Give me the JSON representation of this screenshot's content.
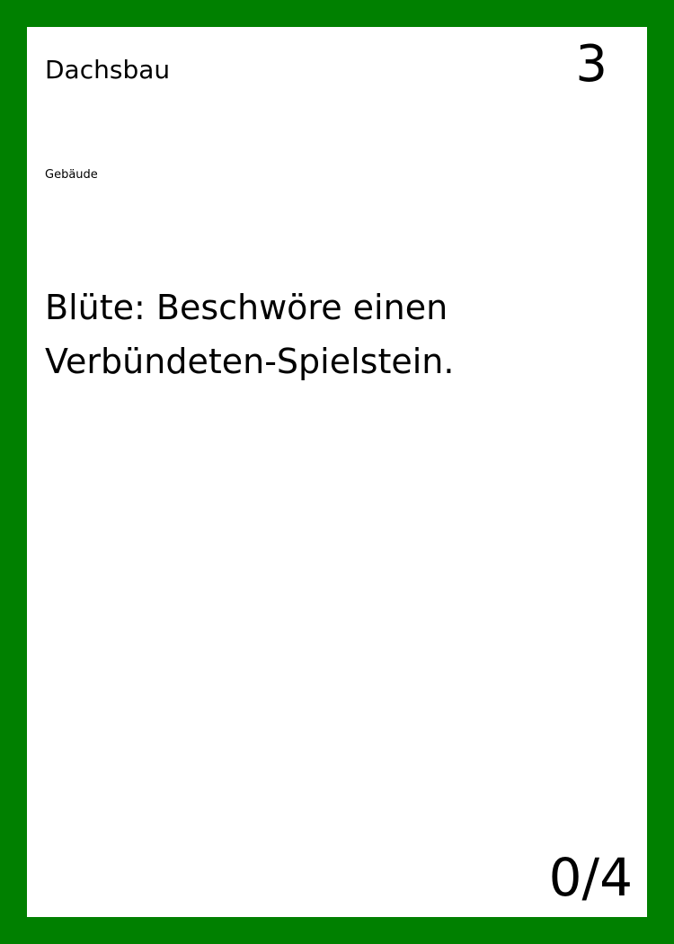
{
  "card": {
    "name": "Dachsbau",
    "cost": "3",
    "type": "Gebäude",
    "text": "Blüte: Beschwöre einen Verbündeten-Spielstein.",
    "counter": "0/4",
    "border_color": "#008000",
    "background_color": "#ffffff"
  }
}
